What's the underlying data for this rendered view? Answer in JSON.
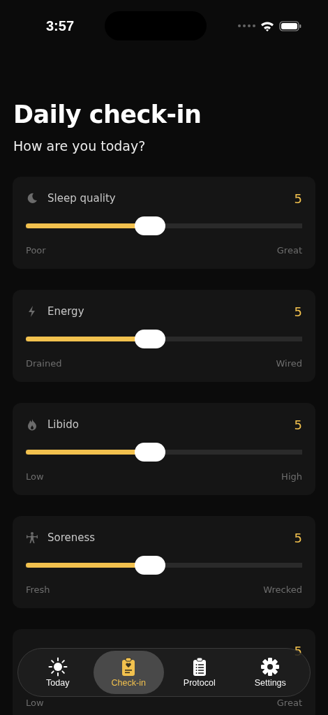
{
  "status_bar": {
    "time": "3:57"
  },
  "header": {
    "title": "Daily check-in",
    "subtitle": "How are you today?"
  },
  "metrics": [
    {
      "title": "Sleep quality",
      "value": "5",
      "level": 0.45,
      "low": "Poor",
      "high": "Great"
    },
    {
      "title": "Energy",
      "value": "5",
      "level": 0.45,
      "low": "Drained",
      "high": "Wired"
    },
    {
      "title": "Libido",
      "value": "5",
      "level": 0.45,
      "low": "Low",
      "high": "High"
    },
    {
      "title": "Soreness",
      "value": "5",
      "level": 0.45,
      "low": "Fresh",
      "high": "Wrecked"
    },
    {
      "value": "5",
      "low": "Low",
      "high": "Great"
    }
  ],
  "tab_bar": [
    {
      "label": "Today",
      "selected": false
    },
    {
      "label": "Check-in",
      "selected": true
    },
    {
      "label": "Protocol",
      "selected": false
    },
    {
      "label": "Settings",
      "selected": false
    }
  ]
}
